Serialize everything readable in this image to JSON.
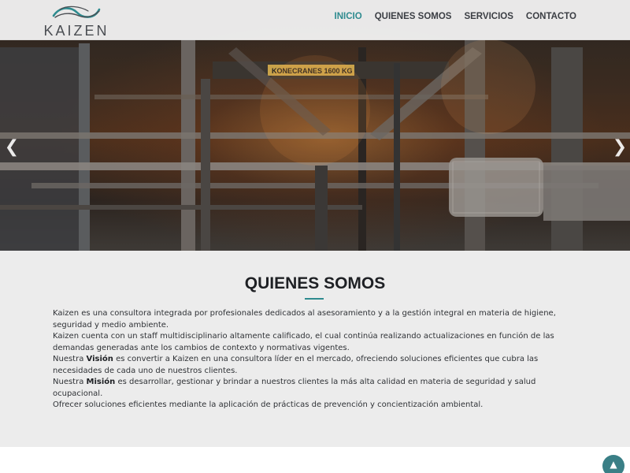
{
  "brand": {
    "name": "KAIZEN",
    "accent_color": "#2e8b8f"
  },
  "nav": {
    "items": [
      {
        "label": "INICIO",
        "active": true
      },
      {
        "label": "QUIENES SOMOS",
        "active": false
      },
      {
        "label": "SERVICIOS",
        "active": false
      },
      {
        "label": "CONTACTO",
        "active": false
      }
    ]
  },
  "hero": {
    "prev_icon": "chevron-left-icon",
    "next_icon": "chevron-right-icon",
    "sign_text": "KONECRANES 1600 KG"
  },
  "about": {
    "title": "QUIENES SOMOS",
    "paragraph_1": "Kaizen es una consultora integrada por profesionales dedicados al asesoramiento y a la gestión integral en materia de higiene, seguridad y medio ambiente.",
    "paragraph_2": "Kaizen cuenta con un staff multidisciplinario altamente calificado, el cual continúa realizando actualizaciones en función de las demandas generadas ante los cambios de contexto y normativas vigentes.",
    "vision_prefix": "Nuestra ",
    "vision_label": "Visión",
    "vision_text": " es convertir a Kaizen en una consultora líder en el mercado, ofreciendo soluciones eficientes que cubra las necesidades de cada uno de nuestros clientes.",
    "mission_prefix": "Nuestra ",
    "mission_label": "Misión",
    "mission_text": " es desarrollar, gestionar y brindar a nuestros clientes la más alta calidad en materia de seguridad y salud ocupacional.",
    "paragraph_last": "Ofrecer soluciones eficientes mediante la aplicación de prácticas de prevención y concientización ambiental."
  },
  "scroll_top": {
    "icon": "chevron-up-icon",
    "glyph": "▲"
  }
}
